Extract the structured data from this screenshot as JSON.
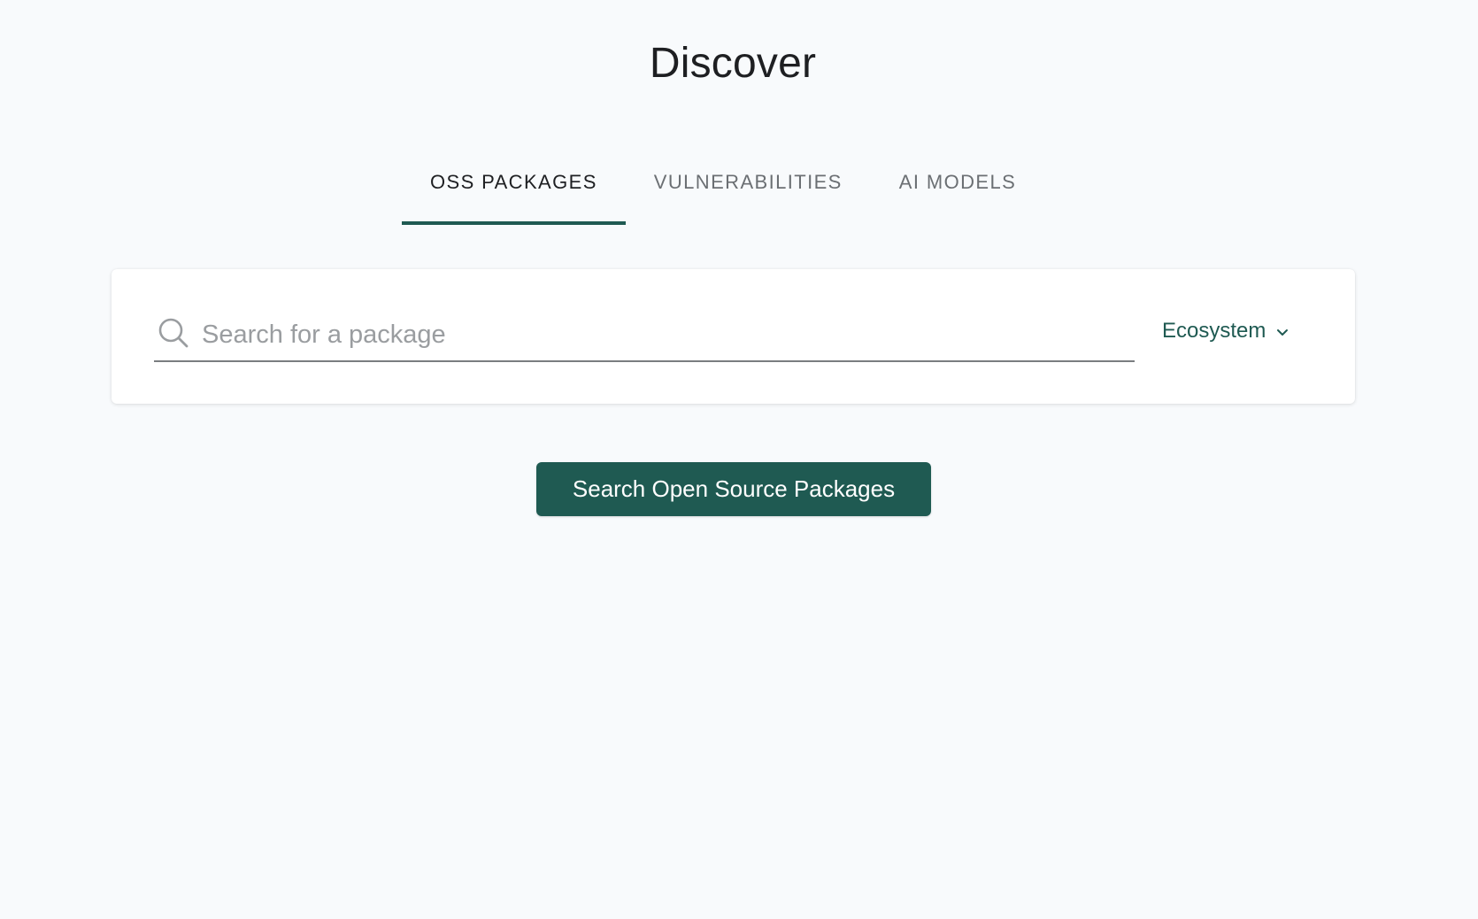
{
  "page": {
    "title": "Discover"
  },
  "tabs": [
    {
      "label": "OSS PACKAGES",
      "active": true
    },
    {
      "label": "VULNERABILITIES",
      "active": false
    },
    {
      "label": "AI MODELS",
      "active": false
    }
  ],
  "search": {
    "placeholder": "Search for a package",
    "value": "",
    "icon": "search-icon"
  },
  "ecosystem": {
    "label": "Ecosystem",
    "icon": "chevron-down-icon"
  },
  "actions": {
    "search_button_label": "Search Open Source Packages"
  },
  "colors": {
    "accent": "#1f5a52",
    "background": "#f8fafc",
    "card": "#ffffff"
  }
}
